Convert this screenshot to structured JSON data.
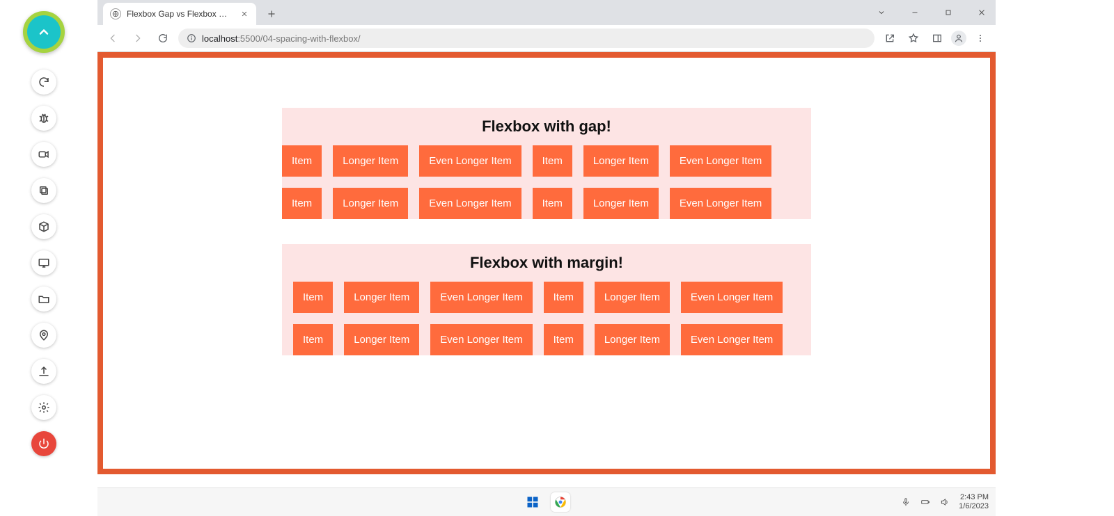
{
  "sidebar": {
    "fab": "collapse",
    "tools": [
      {
        "name": "refresh-icon"
      },
      {
        "name": "bug-icon"
      },
      {
        "name": "video-icon"
      },
      {
        "name": "copy-icon"
      },
      {
        "name": "box-icon"
      },
      {
        "name": "monitor-icon"
      },
      {
        "name": "folder-icon"
      },
      {
        "name": "location-icon"
      },
      {
        "name": "upload-icon"
      },
      {
        "name": "settings-icon"
      },
      {
        "name": "power-icon"
      }
    ]
  },
  "browser": {
    "tab_title": "Flexbox Gap vs Flexbox Margin L...",
    "url_host": "localhost",
    "url_port_path": ":5500/04-spacing-with-flexbox/"
  },
  "page": {
    "section1": {
      "heading": "Flexbox with gap!",
      "items": [
        "Item",
        "Longer Item",
        "Even Longer Item",
        "Item",
        "Longer Item",
        "Even Longer Item",
        "Item",
        "Longer Item",
        "Even Longer Item",
        "Item",
        "Longer Item",
        "Even Longer Item"
      ]
    },
    "section2": {
      "heading": "Flexbox with margin!",
      "items": [
        "Item",
        "Longer Item",
        "Even Longer Item",
        "Item",
        "Longer Item",
        "Even Longer Item",
        "Item",
        "Longer Item",
        "Even Longer Item",
        "Item",
        "Longer Item",
        "Even Longer Item"
      ]
    }
  },
  "taskbar": {
    "time": "2:43 PM",
    "date": "1/6/2023"
  }
}
